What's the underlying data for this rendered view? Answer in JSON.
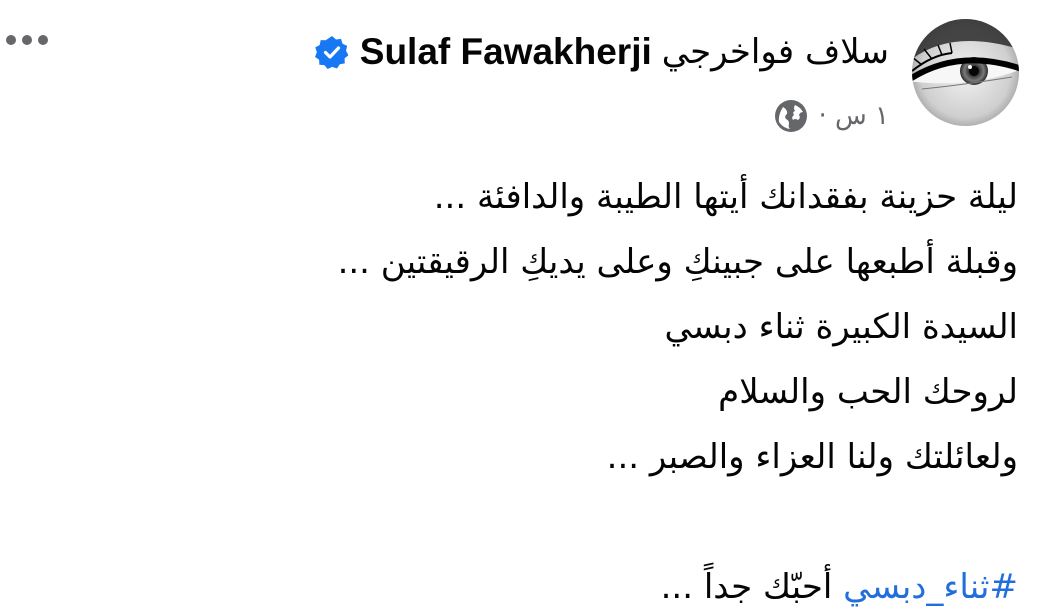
{
  "header": {
    "author_name_arabic": "سلاف فواخرجي",
    "author_name_latin": "Sulaf Fawakherji",
    "verified_icon": "verified-badge-icon",
    "time": "١ س ·",
    "audience_icon": "globe-icon",
    "more_icon": "more-options-icon"
  },
  "post": {
    "lines": [
      "ليلة حزينة بفقدانك أيتها الطيبة والدافئة ...",
      "وقبلة أطبعها على جبينكِ وعلى يديكِ الرقيقتين ...",
      "السيدة الكبيرة  ثناء دبسي",
      "لروحك الحب والسلام",
      "ولعائلتك ولنا  العزاء والصبر ..."
    ],
    "hashtag": "#ثناء_دبسي",
    "last_line_text": " أحبّك جداً ..."
  },
  "colors": {
    "text": "#050505",
    "secondary": "#65676b",
    "link": "#216fdb",
    "verified": "#1877f2"
  }
}
